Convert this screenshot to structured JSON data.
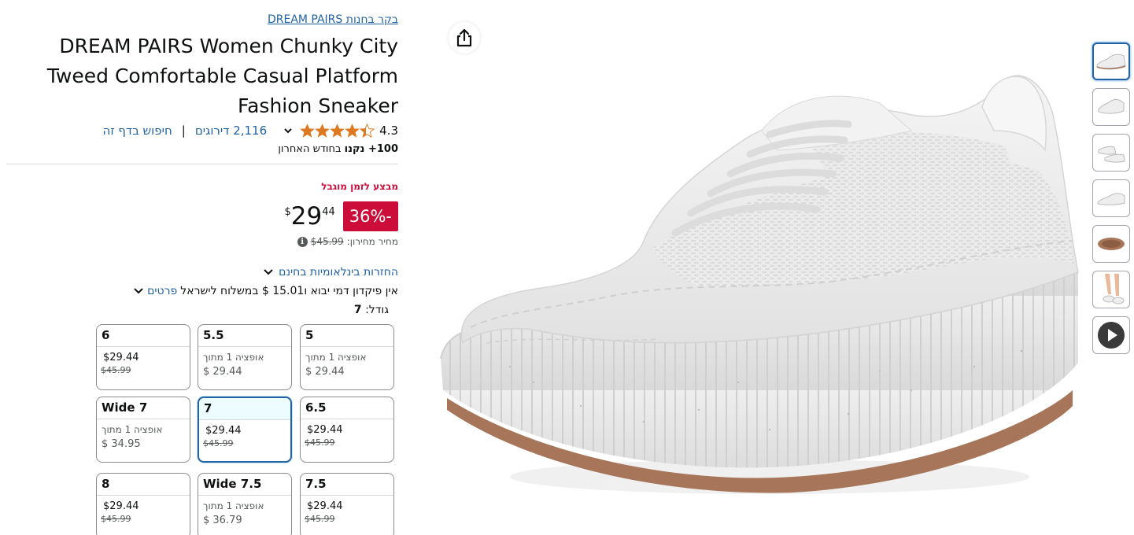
{
  "store_link": "בקר בחנות DREAM PAIRS",
  "title_lines": [
    "DREAM PAIRS Women Chunky City",
    "Tweed Comfortable Casual Platform",
    "Fashion Sneaker"
  ],
  "rating": {
    "value": "4.3",
    "stars": 4.3,
    "count_link": "2,116 דירוגים",
    "separator": "|",
    "search_page": "חיפוש בדף זה"
  },
  "bought": {
    "count": "100+ נקנו",
    "suffix": " בחודש האחרון"
  },
  "deal_badge": "מבצע לזמן מוגבל",
  "price": {
    "discount": "-36%",
    "currency": "$",
    "whole": "29",
    "fraction": "44",
    "list_label": "מחיר מחירון:",
    "list_value": "$45.99"
  },
  "returns_link": "החזרות בינלאומיות בחינם",
  "shipping": {
    "text": "אין פיקדון דמי יבוא ו15.01 $ במשלוח לישראל",
    "details_link": "פרטים"
  },
  "size": {
    "label": "גודל:",
    "selected": "7"
  },
  "size_options": [
    {
      "name": "5",
      "line1": "אופציה 1 מתוך",
      "line2": "$ 29.44",
      "type": "avail"
    },
    {
      "name": "5.5",
      "line1": "אופציה 1 מתוך",
      "line2": "$ 29.44",
      "type": "avail"
    },
    {
      "name": "6",
      "line1": "$29.44",
      "line2": "$45.99",
      "type": "price"
    },
    {
      "name": "6.5",
      "line1": "$29.44",
      "line2": "$45.99",
      "type": "price"
    },
    {
      "name": "7",
      "line1": "$29.44",
      "line2": "$45.99",
      "type": "price",
      "selected": true
    },
    {
      "name": "Wide 7",
      "line1": "אופציה 1 מתוך",
      "line2": "$ 34.95",
      "type": "avail"
    },
    {
      "name": "7.5",
      "line1": "$29.44",
      "line2": "$45.99",
      "type": "price"
    },
    {
      "name": "Wide 7.5",
      "line1": "אופציה 1 מתוך",
      "line2": "$ 36.79",
      "type": "avail"
    },
    {
      "name": "8",
      "line1": "$29.44",
      "line2": "$45.99",
      "type": "price"
    }
  ],
  "thumbnails": [
    "side-view",
    "three-quarter-view",
    "pair-view",
    "top-view",
    "sole-view",
    "on-foot-view",
    "video"
  ],
  "colors": {
    "link": "#2162a1",
    "deal": "#cc0c39",
    "star": "#de7921",
    "selected_border": "#2162a1"
  },
  "icons": {
    "share": "share-icon",
    "chevron": "chevron-down-icon",
    "info": "info-icon",
    "play": "play-icon"
  }
}
